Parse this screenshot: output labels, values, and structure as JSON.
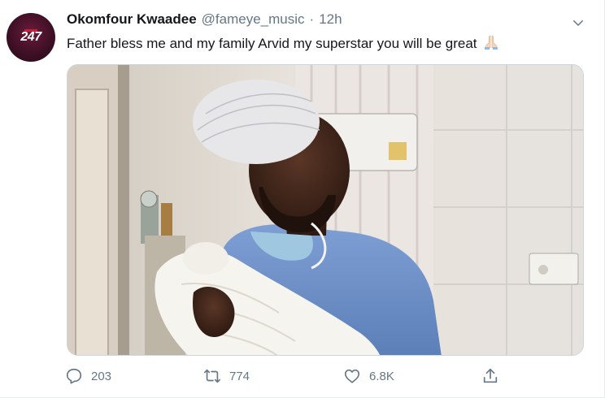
{
  "tweet": {
    "author": {
      "display_name": "Okomfour Kwaadee",
      "handle": "@fameye_music",
      "avatar_text": "247"
    },
    "separator": "·",
    "time": "12h",
    "text": "Father bless me and my family Arvid my superstar you will be great",
    "text_emoji": "folded-hands-icon"
  },
  "actions": {
    "reply_count": "203",
    "retweet_count": "774",
    "like_count": "6.8K"
  },
  "colors": {
    "text_primary": "#14171a",
    "text_secondary": "#657786",
    "border": "#ccd6dd",
    "avatar_bg": "#3b0f24",
    "scrubs": "#6b8fc9"
  }
}
